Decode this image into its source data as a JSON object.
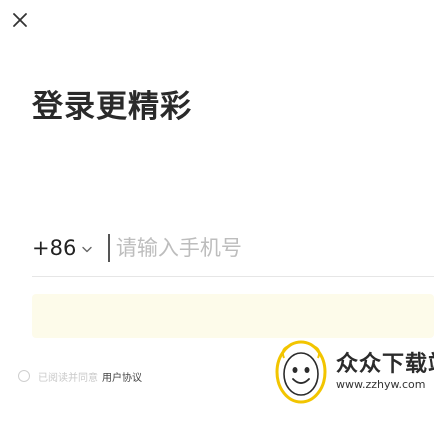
{
  "header": {
    "close_icon": "close-icon",
    "title": "登录更精彩"
  },
  "phone_form": {
    "country_code": "+86",
    "chevron_icon": "chevron-down-icon",
    "phone_value": "",
    "phone_placeholder": "请输入手机号"
  },
  "login_button": {
    "label": ""
  },
  "agreement": {
    "checked": false,
    "text": "已阅读并同意",
    "link_text": "用户协议"
  },
  "watermark": {
    "logo_icon": "smiley-logo-icon",
    "title": "众众下载站",
    "url": "www.zzhyw.com"
  },
  "colors": {
    "text_primary": "#222222",
    "placeholder": "#bdbdbd",
    "button_bg": "#fdfbea",
    "divider": "#e6e6e6",
    "logo_yellow": "#f2c500"
  }
}
